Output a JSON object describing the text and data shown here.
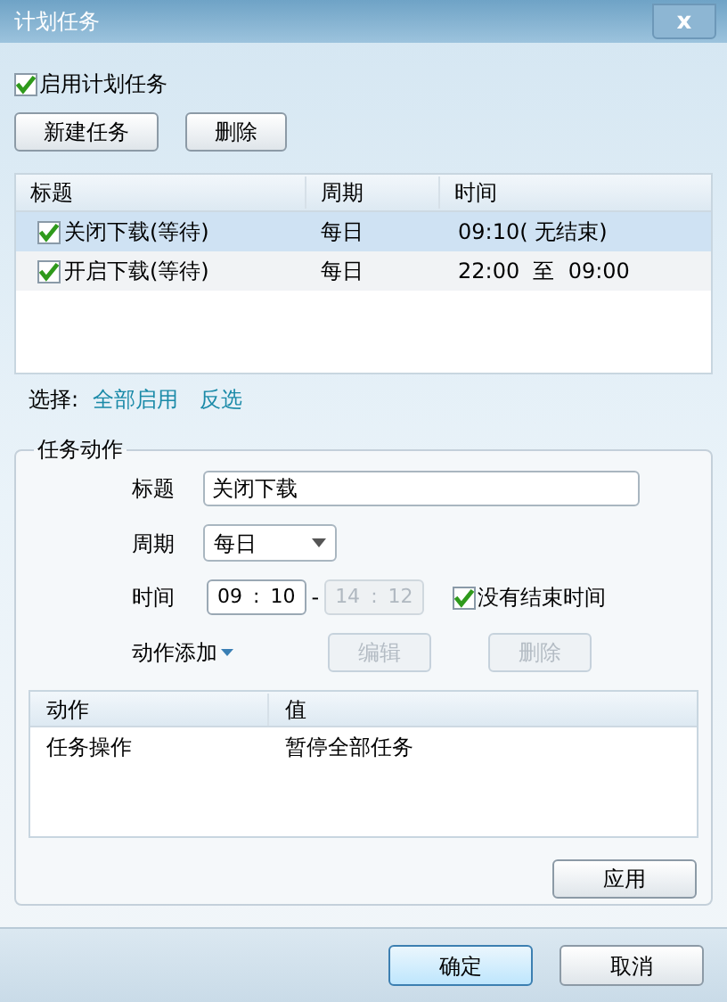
{
  "window": {
    "title": "计划任务",
    "close": "x"
  },
  "enable": {
    "label": "启用计划任务",
    "checked": true
  },
  "toolbar": [
    {
      "label": "新建任务",
      "disabled": false
    },
    {
      "label": "删除",
      "disabled": false
    }
  ],
  "task_list": {
    "columns": [
      "标题",
      "周期",
      "时间"
    ],
    "rows": [
      {
        "title": "关闭下载(等待)",
        "period": "每日",
        "time": "09:10( 无结束)",
        "checked": true,
        "selected": true
      },
      {
        "title": "开启下载(等待)",
        "period": "每日",
        "time": "22:00  至  09:00",
        "checked": true,
        "selected": false
      }
    ]
  },
  "selection": {
    "label": "选择:",
    "links": [
      "全部启用",
      "反选"
    ]
  },
  "action_group": {
    "legend": "任务动作",
    "title_label": "标题",
    "title_value": "关闭下载",
    "period_label": "周期",
    "period_value": "每日",
    "time_label": "时间",
    "start": {
      "hour": "09",
      "sep": ":",
      "minute": "10",
      "disabled": false
    },
    "dash": "-",
    "end": {
      "hour": "14",
      "sep": ":",
      "minute": "12",
      "disabled": true
    },
    "no_end": {
      "label": "没有结束时间",
      "checked": true
    },
    "add_menu": "动作添加",
    "action_buttons": [
      {
        "label": "编辑",
        "disabled": true
      },
      {
        "label": "删除",
        "disabled": true
      }
    ],
    "actions": {
      "columns": [
        "动作",
        "值"
      ],
      "rows": [
        {
          "action": "任务操作",
          "value": "暂停全部任务"
        }
      ]
    },
    "apply": "应用"
  },
  "footer": [
    {
      "label": "确定",
      "focused": true
    },
    {
      "label": "取消",
      "focused": false
    }
  ]
}
